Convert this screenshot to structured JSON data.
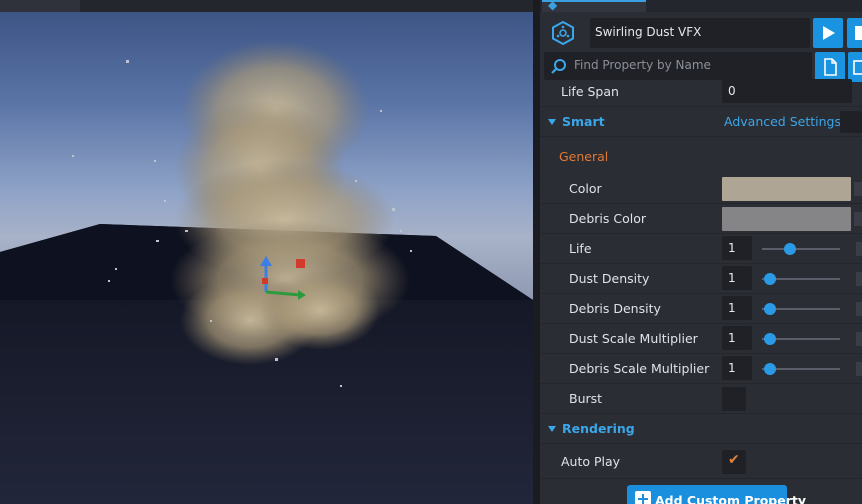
{
  "header": {
    "object_name": "Swirling Dust VFX",
    "search_placeholder": "Find Property by Name"
  },
  "properties": {
    "life_span": {
      "label": "Life Span",
      "value": "0"
    },
    "smart_section": {
      "title": "Smart",
      "advanced_label": "Advanced Settings"
    },
    "general_category": "General",
    "color": {
      "label": "Color",
      "swatch": "#afa595"
    },
    "debris_color": {
      "label": "Debris Color",
      "swatch": "#858588"
    },
    "life": {
      "label": "Life",
      "value": "1",
      "level": 0.36
    },
    "dust_density": {
      "label": "Dust Density",
      "value": "1",
      "level": 0.1
    },
    "debris_density": {
      "label": "Debris Density",
      "value": "1",
      "level": 0.1
    },
    "dust_scale": {
      "label": "Dust Scale Multiplier",
      "value": "1",
      "level": 0.1
    },
    "debris_scale": {
      "label": "Debris Scale Multiplier",
      "value": "1",
      "level": 0.1
    },
    "burst": {
      "label": "Burst",
      "checked": false
    },
    "rendering_section": {
      "title": "Rendering"
    },
    "auto_play": {
      "label": "Auto Play",
      "checked": true
    }
  },
  "footer": {
    "add_custom_property": "Add Custom Property"
  },
  "colors": {
    "accent": "#1a93e0",
    "category": "#e07a35",
    "panel_bg": "#2b2d34"
  }
}
